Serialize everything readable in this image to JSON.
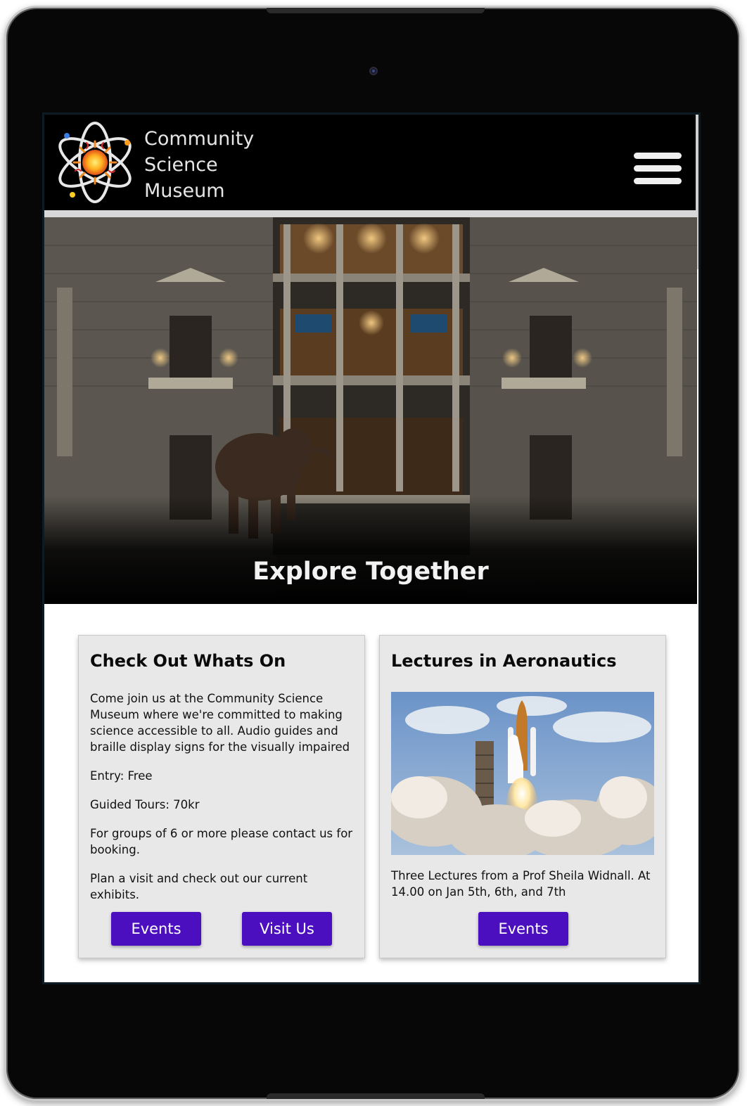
{
  "site": {
    "brand_lines": [
      "Community",
      "Science",
      "Museum"
    ]
  },
  "hero": {
    "title": "Explore Together"
  },
  "cards": {
    "whats_on": {
      "title": "Check Out Whats On",
      "paragraphs": [
        "Come join us at the Community Science Museum where we're committed to making science accessible to all. Audio guides and braille display signs for the visually impaired",
        "Entry: Free",
        "Guided Tours: 70kr",
        "For groups of 6 or more please contact us for booking.",
        "Plan a visit and check out our current exhibits."
      ],
      "events_label": "Events",
      "visit_label": "Visit Us"
    },
    "aeronautics": {
      "title": "Lectures in Aeronautics",
      "caption": "Three Lectures from a Prof Sheila Widnall. At 14.00 on Jan 5th, 6th, and 7th",
      "events_label": "Events"
    }
  },
  "colors": {
    "header_bg": "#000000",
    "button_bg": "#4b0fbf",
    "card_bg": "#e8e8e8"
  },
  "icons": [
    "atom-logo-icon",
    "hamburger-menu-icon"
  ]
}
